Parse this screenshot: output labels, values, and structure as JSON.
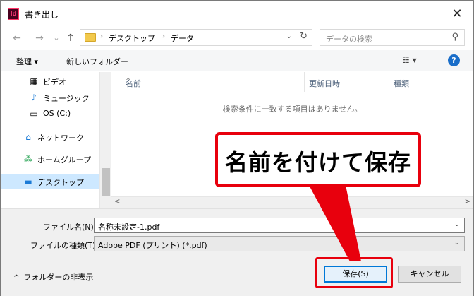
{
  "window": {
    "title": "書き出し",
    "app_icon_text": "Id",
    "close_glyph": "✕"
  },
  "nav": {
    "back_glyph": "←",
    "forward_glyph": "→",
    "history_glyph": "⌄",
    "up_glyph": "↑",
    "breadcrumb": [
      "デスクトップ",
      "データ"
    ],
    "search_placeholder": "データの検索"
  },
  "toolbar": {
    "organize_label": "整理 ▾",
    "new_folder_label": "新しいフォルダー"
  },
  "sidebar": {
    "items": [
      {
        "label": "ビデオ",
        "icon": "film-icon"
      },
      {
        "label": "ミュージック",
        "icon": "music-note-icon"
      },
      {
        "label": "OS (C:)",
        "icon": "drive-icon"
      },
      {
        "label": "ネットワーク",
        "icon": "network-icon"
      },
      {
        "label": "ホームグループ",
        "icon": "homegroup-icon"
      },
      {
        "label": "デスクトップ",
        "icon": "desktop-icon",
        "selected": true
      }
    ]
  },
  "filelist": {
    "columns": [
      "名前",
      "更新日時",
      "種類"
    ],
    "empty_message": "検索条件に一致する項目はありません。"
  },
  "form": {
    "filename_label": "ファイル名(N):",
    "filename_value": "名称未設定-1.pdf",
    "filetype_label": "ファイルの種類(T):",
    "filetype_value": "Adobe PDF (プリント) (*.pdf)"
  },
  "footer": {
    "hide_folders_label": "フォルダーの非表示",
    "save_label": "保存(S)",
    "cancel_label": "キャンセル"
  },
  "annotation": {
    "callout_text": "名前を付けて保存",
    "accent_color": "#e8000d"
  }
}
